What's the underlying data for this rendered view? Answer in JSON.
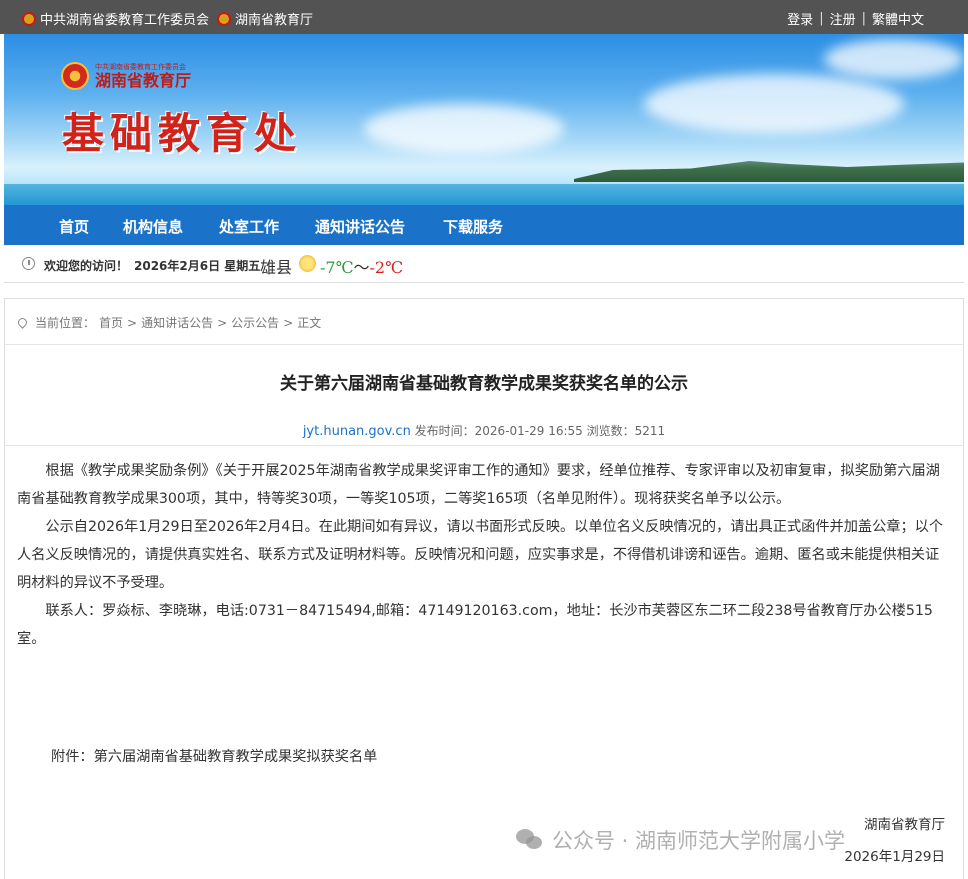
{
  "topbar": {
    "org1": "中共湖南省委教育工作委员会",
    "org2": "湖南省教育厅",
    "login": "登录",
    "register": "注册",
    "lang": "繁體中文",
    "sep": "|"
  },
  "banner": {
    "small_org": "中共湖南省委教育工作委员会",
    "dept": "湖南省教育厅",
    "title": "基础教育处"
  },
  "nav": {
    "items": [
      "首页",
      "机构信息",
      "处室工作",
      "通知讲话公告",
      "下载服务"
    ]
  },
  "welcome": {
    "message": "欢迎您的访问！",
    "date": "2026年2月6日 星期五",
    "city": "雄县",
    "temp_low": "-7℃",
    "temp_sep": "～",
    "temp_high": "-2℃"
  },
  "breadcrumb": {
    "prefix": "当前位置：",
    "items": [
      "首页",
      "通知讲话公告",
      "公示公告",
      "正文"
    ],
    "sep": ">"
  },
  "article": {
    "title": "关于第六届湖南省基础教育教学成果奖获奖名单的公示",
    "source": "jyt.hunan.gov.cn",
    "publish_label": "发布时间：",
    "publish_time": "2026-01-29 16:55",
    "views_label": "浏览数：",
    "views": "5211",
    "paragraphs": [
      "根据《教学成果奖励条例》《关于开展2025年湖南省教学成果奖评审工作的通知》要求，经单位推荐、专家评审以及初审复审，拟奖励第六届湖南省基础教育教学成果300项，其中，特等奖30项，一等奖105项，二等奖165项（名单见附件）。现将获奖名单予以公示。",
      "公示自2026年1月29日至2026年2月4日。在此期间如有异议，请以书面形式反映。以单位名义反映情况的，请出具正式函件并加盖公章；以个人名义反映情况的，请提供真实姓名、联系方式及证明材料等。反映情况和问题，应实事求是，不得借机诽谤和诬告。逾期、匿名或未能提供相关证明材料的异议不予受理。",
      "联系人：罗焱标、李晓琳，电话:0731－84715494,邮箱：47149120163.com，地址：长沙市芙蓉区东二环二段238号省教育厅办公楼515室。"
    ],
    "attachment": "附件：第六届湖南省基础教育教学成果奖拟获奖名单",
    "sign_org": "湖南省教育厅",
    "sign_date": "2026年1月29日"
  },
  "watermark": {
    "text": "公众号 · 湖南师范大学附属小学"
  }
}
